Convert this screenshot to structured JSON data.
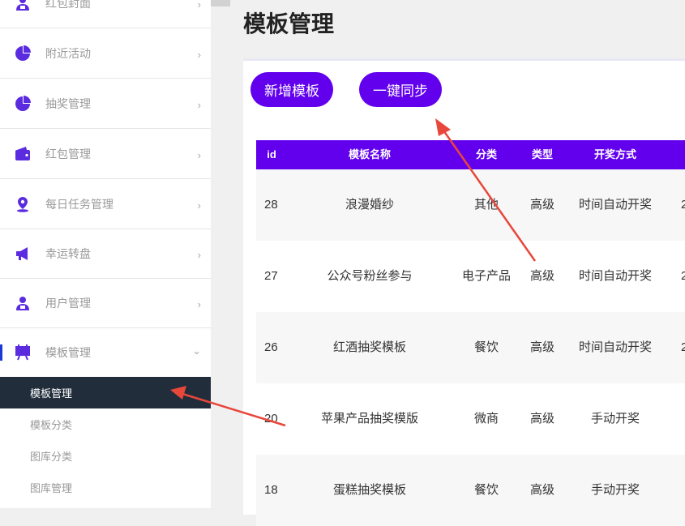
{
  "sidebar": {
    "items": [
      {
        "label": "红包封面",
        "icon": "user-badge-icon"
      },
      {
        "label": "附近活动",
        "icon": "pie-chart-icon"
      },
      {
        "label": "抽奖管理",
        "icon": "pie-chart-icon"
      },
      {
        "label": "红包管理",
        "icon": "wallet-icon"
      },
      {
        "label": "每日任务管理",
        "icon": "location-pin-icon"
      },
      {
        "label": "幸运转盘",
        "icon": "megaphone-icon"
      },
      {
        "label": "用户管理",
        "icon": "user-badge-icon"
      },
      {
        "label": "模板管理",
        "icon": "board-icon"
      }
    ],
    "sub_items": [
      {
        "label": "模板管理",
        "active": true
      },
      {
        "label": "模板分类",
        "active": false
      },
      {
        "label": "图库分类",
        "active": false
      },
      {
        "label": "图库管理",
        "active": false
      }
    ],
    "chevron_right": "›",
    "chevron_down": "⌄"
  },
  "main": {
    "title": "模板管理",
    "buttons": {
      "add": "新增模板",
      "sync": "一键同步"
    }
  },
  "table": {
    "headers": [
      "id",
      "模板名称",
      "分类",
      "类型",
      "开奖方式"
    ],
    "rows": [
      {
        "id": "28",
        "name": "浪漫婚纱",
        "category": "其他",
        "type": "高级",
        "draw": "时间自动开奖",
        "extra": "2"
      },
      {
        "id": "27",
        "name": "公众号粉丝参与",
        "category": "电子产品",
        "type": "高级",
        "draw": "时间自动开奖",
        "extra": "2"
      },
      {
        "id": "26",
        "name": "红酒抽奖模板",
        "category": "餐饮",
        "type": "高级",
        "draw": "时间自动开奖",
        "extra": "2"
      },
      {
        "id": "20",
        "name": "苹果产品抽奖模版",
        "category": "微商",
        "type": "高级",
        "draw": "手动开奖",
        "extra": ""
      },
      {
        "id": "18",
        "name": "蛋糕抽奖模板",
        "category": "餐饮",
        "type": "高级",
        "draw": "手动开奖",
        "extra": ""
      }
    ]
  },
  "colors": {
    "accent": "#6200ee",
    "annotation_arrow": "#e8473b",
    "active_sub_bg": "#212d3b",
    "active_bar": "#1a3ad6"
  }
}
